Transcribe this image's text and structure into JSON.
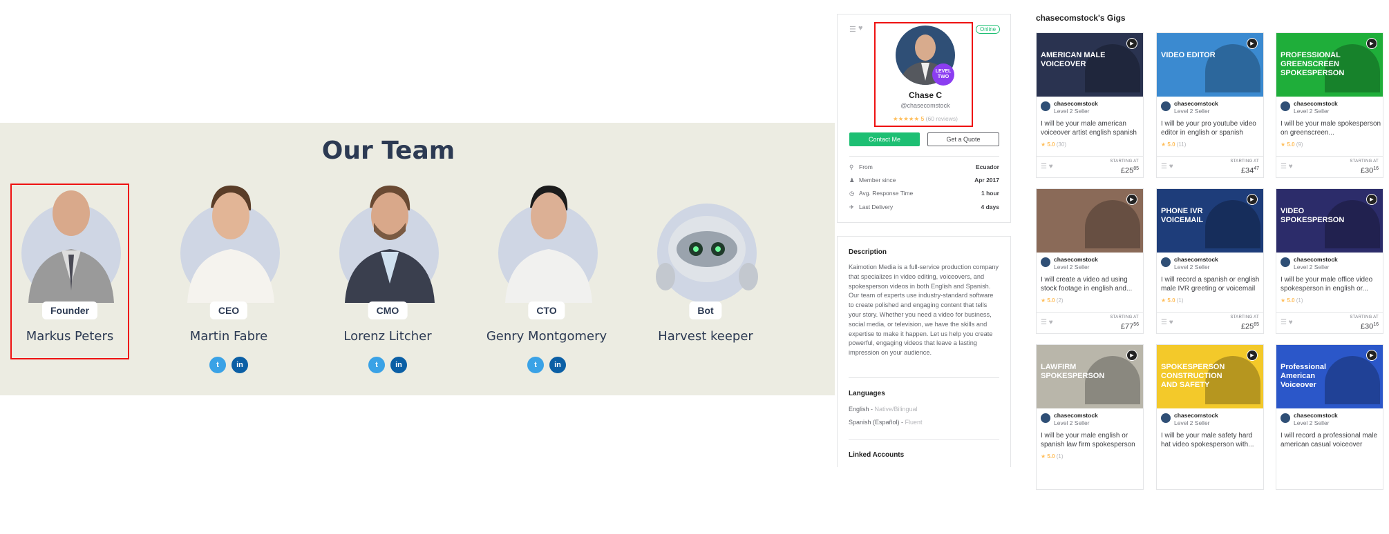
{
  "team": {
    "heading": "Our Team",
    "members": [
      {
        "role": "Founder",
        "name": "Markus Peters",
        "social": false
      },
      {
        "role": "CEO",
        "name": "Martin Fabre",
        "social": true
      },
      {
        "role": "CMO",
        "name": "Lorenz Litcher",
        "social": true
      },
      {
        "role": "CTO",
        "name": "Genry Montgomery",
        "social": true
      },
      {
        "role": "Bot",
        "name": "Harvest keeper",
        "social": false
      }
    ],
    "twitter_glyph": "t",
    "linkedin_glyph": "in"
  },
  "profile": {
    "online": "Online",
    "level_badge": "LEVEL TWO",
    "name": "Chase C",
    "username": "@chasecomstock",
    "stars": "★★★★★",
    "rating": "5",
    "reviews": "(60 reviews)",
    "contact_label": "Contact Me",
    "quote_label": "Get a Quote",
    "stats": [
      {
        "icon": "location-icon",
        "glyph": "⚲",
        "label": "From",
        "value": "Ecuador"
      },
      {
        "icon": "user-icon",
        "glyph": "♟",
        "label": "Member since",
        "value": "Apr 2017"
      },
      {
        "icon": "clock-icon",
        "glyph": "◷",
        "label": "Avg. Response Time",
        "value": "1 hour"
      },
      {
        "icon": "send-icon",
        "glyph": "✈",
        "label": "Last Delivery",
        "value": "4 days"
      }
    ],
    "description_heading": "Description",
    "description": "Kaimotion Media is a full-service production company that specializes in video editing, voiceovers, and spokesperson videos in both English and Spanish. Our team of experts use industry-standard software to create polished and engaging content that tells your story. Whether you need a video for business, social media, or television, we have the skills and expertise to make it happen. Let us help you create powerful, engaging videos that leave a lasting impression on your audience.",
    "languages_heading": "Languages",
    "languages": [
      {
        "lang": "English",
        "level": "Native/Bilingual"
      },
      {
        "lang": "Spanish (Español)",
        "level": "Fluent"
      }
    ],
    "linked_heading": "Linked Accounts"
  },
  "gigs_heading": "chasecomstock's Gigs",
  "gigs": [
    {
      "thumb_text": "AMERICAN MALE VOICEOVER",
      "thumb_bg": "#2a3350",
      "seller": "chasecomstock",
      "level": "Level 2 Seller",
      "title": "I will be your male american voiceover artist english spanish",
      "rating": "5.0",
      "count": "(30)",
      "starting": "STARTING AT",
      "price": "£25",
      "cents": "85"
    },
    {
      "thumb_text": "VIDEO EDITOR",
      "thumb_bg": "#3b8ad0",
      "seller": "chasecomstock",
      "level": "Level 2 Seller",
      "title": "I will be your pro youtube video editor in english or spanish",
      "rating": "5.0",
      "count": "(11)",
      "starting": "STARTING AT",
      "price": "£34",
      "cents": "47"
    },
    {
      "thumb_text": "PROFESSIONAL GREENSCREEN SPOKESPERSON",
      "thumb_bg": "#1fae3a",
      "seller": "chasecomstock",
      "level": "Level 2 Seller",
      "title": "I will be your male spokesperson on greenscreen...",
      "rating": "5.0",
      "count": "(9)",
      "starting": "STARTING AT",
      "price": "£30",
      "cents": "16"
    },
    {
      "thumb_text": "",
      "thumb_bg": "#8a6a58",
      "seller": "chasecomstock",
      "level": "Level 2 Seller",
      "title": "I will create a video ad using stock footage in english and...",
      "rating": "5.0",
      "count": "(2)",
      "starting": "STARTING AT",
      "price": "£77",
      "cents": "56"
    },
    {
      "thumb_text": "PHONE IVR VOICEMAIL",
      "thumb_bg": "#1e3d7a",
      "seller": "chasecomstock",
      "level": "Level 2 Seller",
      "title": "I will record a spanish or english male IVR greeting or voicemail",
      "rating": "5.0",
      "count": "(1)",
      "starting": "STARTING AT",
      "price": "£25",
      "cents": "85"
    },
    {
      "thumb_text": "VIDEO SPOKESPERSON",
      "thumb_bg": "#2c2c6a",
      "seller": "chasecomstock",
      "level": "Level 2 Seller",
      "title": "I will be your male office video spokesperson in english or...",
      "rating": "5.0",
      "count": "(1)",
      "starting": "STARTING AT",
      "price": "£30",
      "cents": "16"
    },
    {
      "thumb_text": "LAWFIRM SPOKESPERSON",
      "thumb_bg": "#b9b6aa",
      "seller": "chasecomstock",
      "level": "Level 2 Seller",
      "title": "I will be your male english or spanish law firm spokesperson",
      "rating": "5.0",
      "count": "(1)",
      "starting": "",
      "price": "",
      "cents": ""
    },
    {
      "thumb_text": "SPOKESPERSON CONSTRUCTION AND SAFETY",
      "thumb_bg": "#f3c92a",
      "seller": "chasecomstock",
      "level": "Level 2 Seller",
      "title": "I will be your male safety hard hat video spokesperson with...",
      "rating": "",
      "count": "",
      "starting": "",
      "price": "",
      "cents": ""
    },
    {
      "thumb_text": "Professional American Voiceover",
      "thumb_bg": "#2b57c9",
      "seller": "chasecomstock",
      "level": "Level 2 Seller",
      "title": "I will record a professional male american casual voiceover",
      "rating": "",
      "count": "",
      "starting": "",
      "price": "",
      "cents": ""
    }
  ]
}
